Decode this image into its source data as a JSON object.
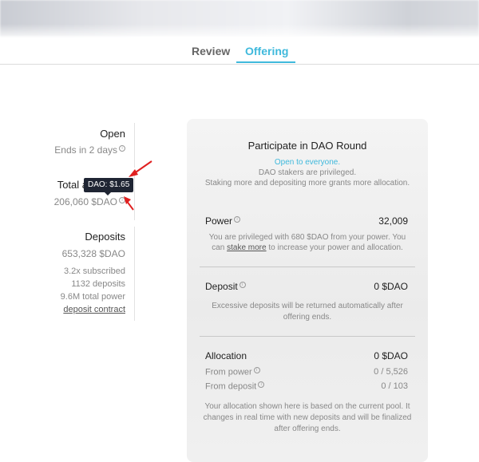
{
  "tabs": [
    {
      "label": "Review",
      "active": false
    },
    {
      "label": "Offering",
      "active": true
    }
  ],
  "accent_color": "#3fb9dc",
  "stats": {
    "open": {
      "title": "Open",
      "subtitle": "Ends in 2 days"
    },
    "total": {
      "title_visible": "Total a",
      "value": "206,060 $DAO"
    },
    "tooltip": "DAO: $1.65",
    "deposits": {
      "title": "Deposits",
      "value": "653,328 $DAO",
      "subscribed": "3.2x subscribed",
      "count": "1132 deposits",
      "power": "9.6M total power",
      "contract_link": "deposit contract"
    }
  },
  "panel": {
    "title": "Participate in DAO Round",
    "open_note": "Open to everyone.",
    "stakers_note": "DAO stakers are privileged.",
    "staking_note": "Staking more and depositing more grants more allocation.",
    "power": {
      "label": "Power",
      "value": "32,009",
      "note_line1": "You are privileged with 680 $DAO from your power. You",
      "note_prefix": "can",
      "link": "stake more",
      "note_suffix": "to increase your power and allocation."
    },
    "deposit": {
      "label": "Deposit",
      "value": "0 $DAO",
      "note_line1": "Excessive deposits will be returned automatically after",
      "note_line2": "offering ends."
    },
    "allocation": {
      "label": "Allocation",
      "value": "0 $DAO",
      "from_power_label": "From power",
      "from_power_value": "0 / 5,526",
      "from_deposit_label": "From deposit",
      "from_deposit_value": "0 / 103",
      "note_line1": "Your allocation shown here is based on the current pool. It",
      "note_line2": "changes in real time with new deposits and will be finalized",
      "note_line3": "after offering ends."
    }
  }
}
